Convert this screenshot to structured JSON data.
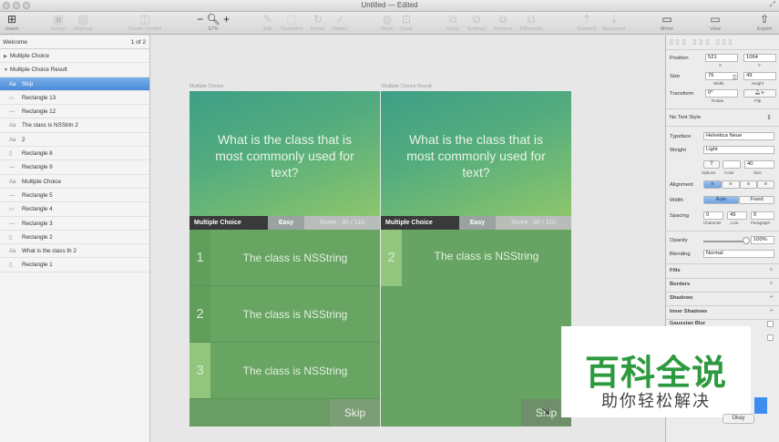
{
  "window": {
    "title": "Untitled — Edited"
  },
  "toolbar": {
    "insert": "Insert",
    "group": "Group",
    "ungroup": "Ungroup",
    "create_symbol": "Create Symbol",
    "zoom_minus": "−",
    "zoom_plus": "+",
    "zoom_value": "57%",
    "edit": "Edit",
    "transform": "Transform",
    "rotate": "Rotate",
    "flatten": "Flatten",
    "mask": "Mask",
    "scale": "Scale",
    "union": "Union",
    "subtract": "Subtract",
    "intersect": "Intersect",
    "difference": "Difference",
    "forward": "Forward",
    "backward": "Backward",
    "mirror": "Mirror",
    "view": "View",
    "export": "Export"
  },
  "layers": {
    "page_name": "Welcome",
    "page_count": "1 of 2",
    "items": [
      {
        "label": "Multiple Choice",
        "icon": "artboard-icon"
      },
      {
        "label": "Multiple Choice Result",
        "icon": "artboard-icon"
      },
      {
        "label": "Skip",
        "icon": "text-icon",
        "icon_glyph": "Aa"
      },
      {
        "label": "Rectangle 13",
        "icon": "rect-icon",
        "icon_glyph": "▭"
      },
      {
        "label": "Rectangle 12",
        "icon": "line-icon",
        "icon_glyph": "—"
      },
      {
        "label": "The class is NSStrin 2",
        "icon": "text-icon",
        "icon_glyph": "Aa"
      },
      {
        "label": "2",
        "icon": "text-icon",
        "icon_glyph": "Aa"
      },
      {
        "label": "Rectangle 8",
        "icon": "tall-rect-icon",
        "icon_glyph": "▯"
      },
      {
        "label": "Rectangle 9",
        "icon": "line-icon",
        "icon_glyph": "—"
      },
      {
        "label": "Multiple Choice",
        "icon": "text-icon",
        "icon_glyph": "Aa"
      },
      {
        "label": "Rectangle 5",
        "icon": "line-icon",
        "icon_glyph": "—"
      },
      {
        "label": "Rectangle 4",
        "icon": "rect-icon",
        "icon_glyph": "▭"
      },
      {
        "label": "Rectangle 3",
        "icon": "line-icon",
        "icon_glyph": "—"
      },
      {
        "label": "Rectangle 2",
        "icon": "square-icon",
        "icon_glyph": "▯"
      },
      {
        "label": "What is the class th 2",
        "icon": "text-icon",
        "icon_glyph": "Aa"
      },
      {
        "label": "Rectangle 1",
        "icon": "square-icon",
        "icon_glyph": "▯"
      }
    ]
  },
  "canvas": {
    "artboard1": {
      "label": "Multiple Choice",
      "question": "What is the class that is most commonly used for text?",
      "bar_mc": "Multiple Choice",
      "bar_easy": "Easy",
      "bar_score": "Score : 90 / 110",
      "answers": [
        {
          "num": "1",
          "text": "The class is NSString"
        },
        {
          "num": "2",
          "text": "The class is NSString"
        },
        {
          "num": "3",
          "text": "The class is NSString"
        }
      ],
      "skip": "Skip"
    },
    "artboard2": {
      "label": "Multiple Choice Result",
      "question": "What is the class that is most commonly used for text?",
      "bar_mc": "Multiple Choice",
      "bar_easy": "Easy",
      "bar_score": "Score : 90 / 110",
      "answers": [
        {
          "num": "2",
          "text": "The class is NSString"
        }
      ],
      "skip": "Skip"
    }
  },
  "inspector": {
    "position_label": "Position",
    "x": "521",
    "y": "1064",
    "x_sub": "X",
    "y_sub": "Y",
    "size_label": "Size",
    "width": "76",
    "height": "49",
    "width_sub": "Width",
    "height_sub": "Height",
    "transform_label": "Transform",
    "rotate": "0°",
    "rotate_sub": "Rotate",
    "flip_sub": "Flip",
    "text_style": "No Text Style",
    "typeface_label": "Typeface",
    "typeface": "Helvetica Neue",
    "weight_label": "Weight",
    "weight": "Light",
    "t_glyph": "T",
    "font_size": "40",
    "options_sub": "Options",
    "color_sub": "Color",
    "size_sub": "Size",
    "alignment_label": "Alignment",
    "width_label": "Width",
    "auto": "Auto",
    "fixed": "Fixed",
    "spacing_label": "Spacing",
    "char_spacing": "0",
    "line_spacing": "49",
    "para_spacing": "0",
    "character_sub": "Character",
    "line_sub": "Line",
    "paragraph_sub": "Paragraph",
    "opacity_label": "Opacity",
    "opacity": "100%",
    "blending_label": "Blending",
    "blending": "Normal",
    "fills": "Fills",
    "borders": "Borders",
    "shadows": "Shadows",
    "inner_shadows": "Inner Shadows",
    "gaussian": "Gaussian Blur"
  },
  "watermark": {
    "main": "百科全说",
    "sub": "助你轻松解决"
  },
  "dialog": {
    "ok": "Okay"
  }
}
